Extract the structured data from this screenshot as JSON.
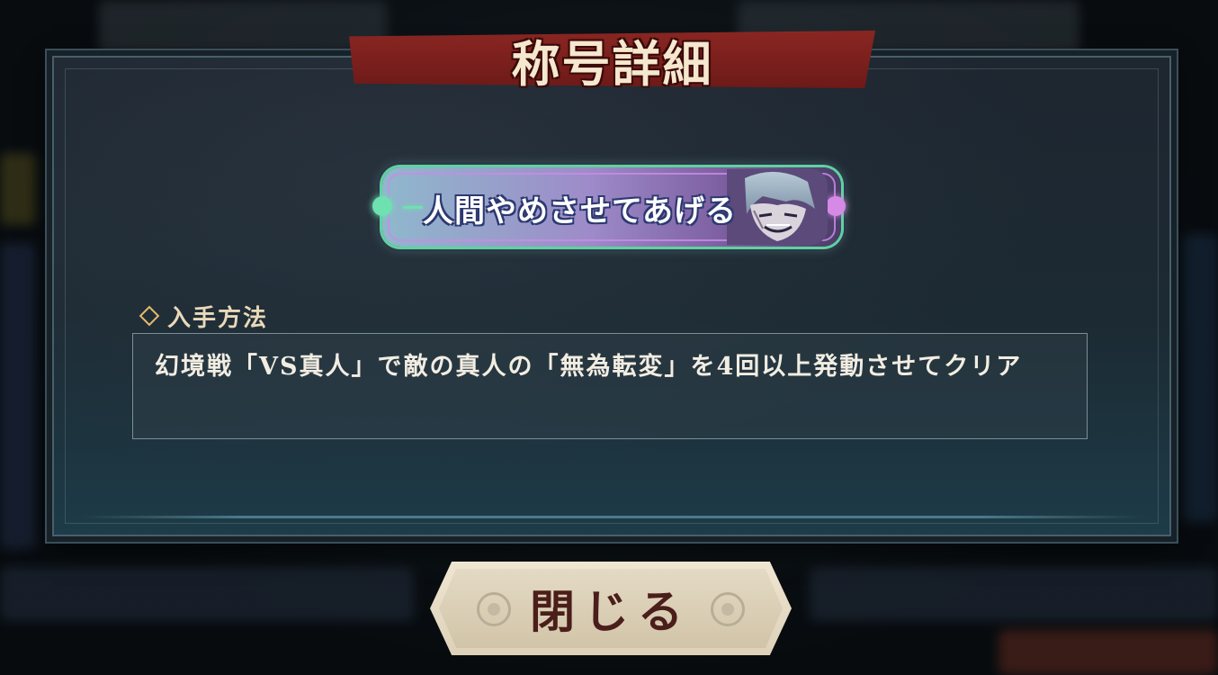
{
  "dialog": {
    "title": "称号詳細",
    "badge": {
      "title_text": "人間やめさせてあげる",
      "portrait_icon": "character-portrait-icon"
    },
    "acquisition": {
      "section_label": "入手方法",
      "description": "幻境戦「VS真人」で敵の真人の「無為転変」を4回以上発動させてクリア"
    },
    "close_button_label": "閉じる"
  },
  "colors": {
    "title_banner": "#8a2622",
    "badge_accent_green": "#6fe0b0",
    "badge_accent_purple": "#d58ae6",
    "panel_border": "#47606c",
    "close_button_bg": "#efe6d2",
    "close_button_text": "#4a1e1a"
  }
}
